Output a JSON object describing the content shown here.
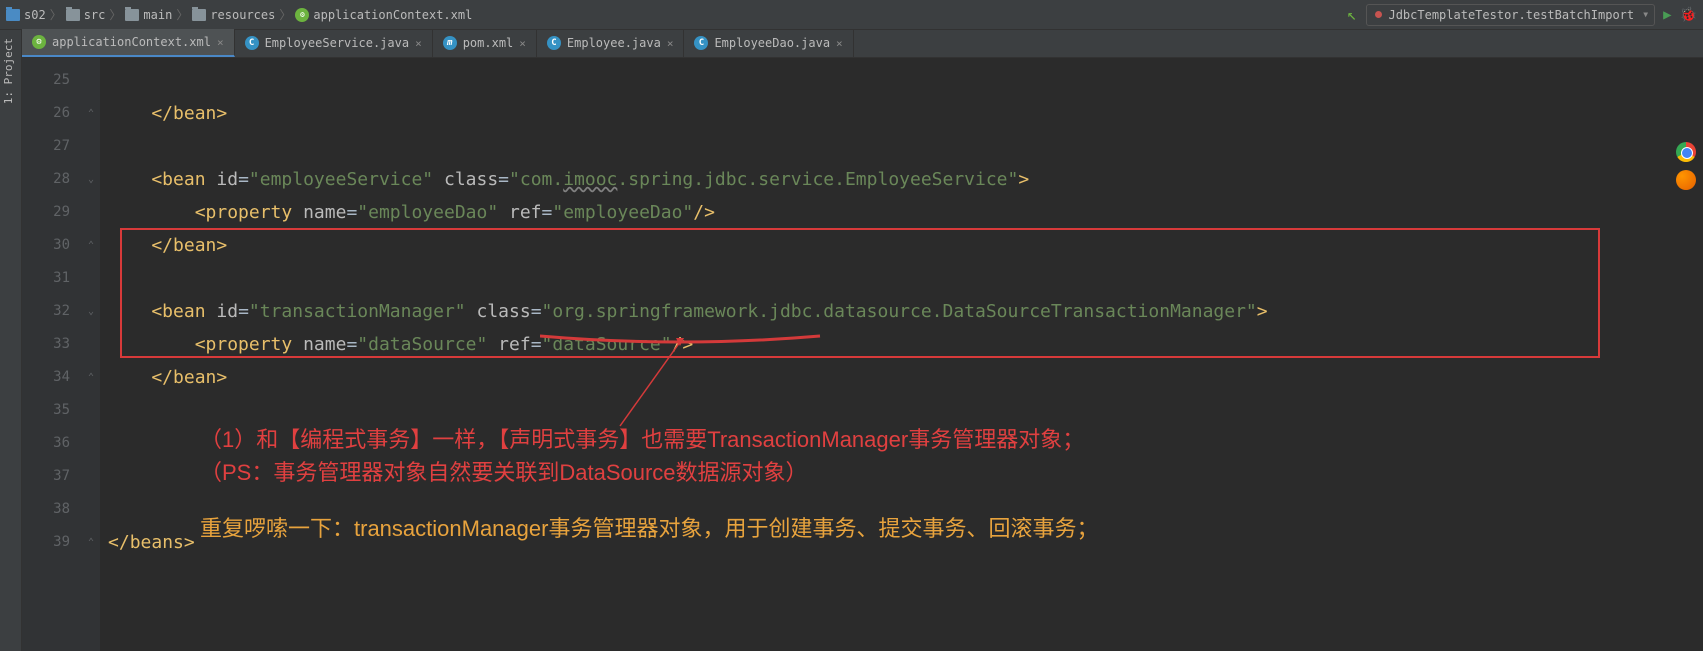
{
  "breadcrumbs": [
    {
      "label": "s02",
      "type": "folder-blue"
    },
    {
      "label": "src",
      "type": "folder"
    },
    {
      "label": "main",
      "type": "folder"
    },
    {
      "label": "resources",
      "type": "folder"
    },
    {
      "label": "applicationContext.xml",
      "type": "xml"
    }
  ],
  "run_config": "JdbcTemplateTestor.testBatchImport",
  "sidebar": {
    "project_label": "1: Project"
  },
  "tabs": [
    {
      "label": "applicationContext.xml",
      "icon": "spring",
      "active": true
    },
    {
      "label": "EmployeeService.java",
      "icon": "java",
      "active": false
    },
    {
      "label": "pom.xml",
      "icon": "maven",
      "active": false,
      "prefix": "m"
    },
    {
      "label": "Employee.java",
      "icon": "java",
      "active": false
    },
    {
      "label": "EmployeeDao.java",
      "icon": "java",
      "active": false
    }
  ],
  "line_numbers": [
    "",
    "25",
    "26",
    "27",
    "28",
    "29",
    "30",
    "31",
    "32",
    "33",
    "34",
    "35",
    "36",
    "37",
    "38",
    "39"
  ],
  "code": {
    "l25": "    </bean>",
    "l27_open": "    <bean ",
    "l27_id_attr": "id",
    "l27_id_val": "\"employeeService\"",
    "l27_class_attr": " class",
    "l27_class_val": "\"com.imooc.spring.jdbc.service.EmployeeService\"",
    "l27_class_val_pre": "\"com.",
    "l27_class_val_wavy": "imooc",
    "l27_class_val_post": ".spring.jdbc.service.EmployeeService\"",
    "l27_close": ">",
    "l28_open": "        <property ",
    "l28_name_attr": "name",
    "l28_name_val": "\"employeeDao\"",
    "l28_ref_attr": " ref",
    "l28_ref_val": "\"employeeDao\"",
    "l28_close": "/>",
    "l29": "    </bean>",
    "l31_open": "    <bean ",
    "l31_id_attr": "id",
    "l31_id_val": "\"transactionManager\"",
    "l31_class_attr": " class",
    "l31_class_val": "\"org.springframework.jdbc.datasource.DataSourceTransactionManager\"",
    "l31_close": ">",
    "l32_open": "        <property ",
    "l32_name_attr": "name",
    "l32_name_val": "\"dataSource\"",
    "l32_ref_attr": " ref",
    "l32_ref_val": "\"dataSource\"",
    "l32_close": "/>",
    "l33": "    </bean>",
    "l38_open": "</",
    "l38_tag": "beans",
    "l38_close": ">"
  },
  "annotations": {
    "red1": "（1）和【编程式事务】一样，【声明式事务】也需要TransactionManager事务管理器对象；",
    "red2": "（PS：事务管理器对象自然要关联到DataSource数据源对象）",
    "orange": "重复啰嗦一下：transactionManager事务管理器对象，用于创建事务、提交事务、回滚事务；"
  }
}
